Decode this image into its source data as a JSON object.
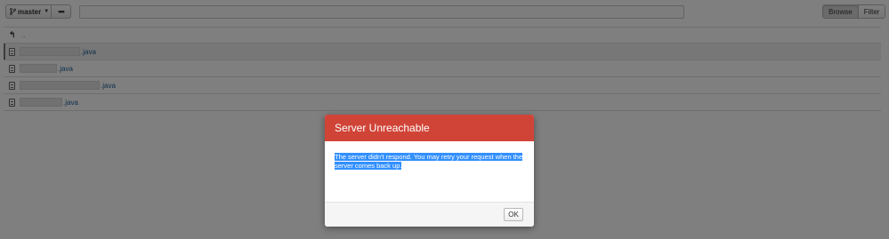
{
  "toolbar": {
    "branch_label": "master",
    "branch_icon": "branch-icon",
    "more_label": "•••",
    "path_value": "",
    "browse_label": "Browse",
    "filter_label": "Filter"
  },
  "files": {
    "up_label": "..",
    "items": [
      {
        "ext": ".java"
      },
      {
        "ext": ".java"
      },
      {
        "ext": ".java"
      },
      {
        "ext": ".java"
      }
    ]
  },
  "dialog": {
    "title": "Server Unreachable",
    "message": "The server didn't respond. You may retry your request when the server comes back up.",
    "ok_label": "OK",
    "header_color": "#d04437"
  }
}
